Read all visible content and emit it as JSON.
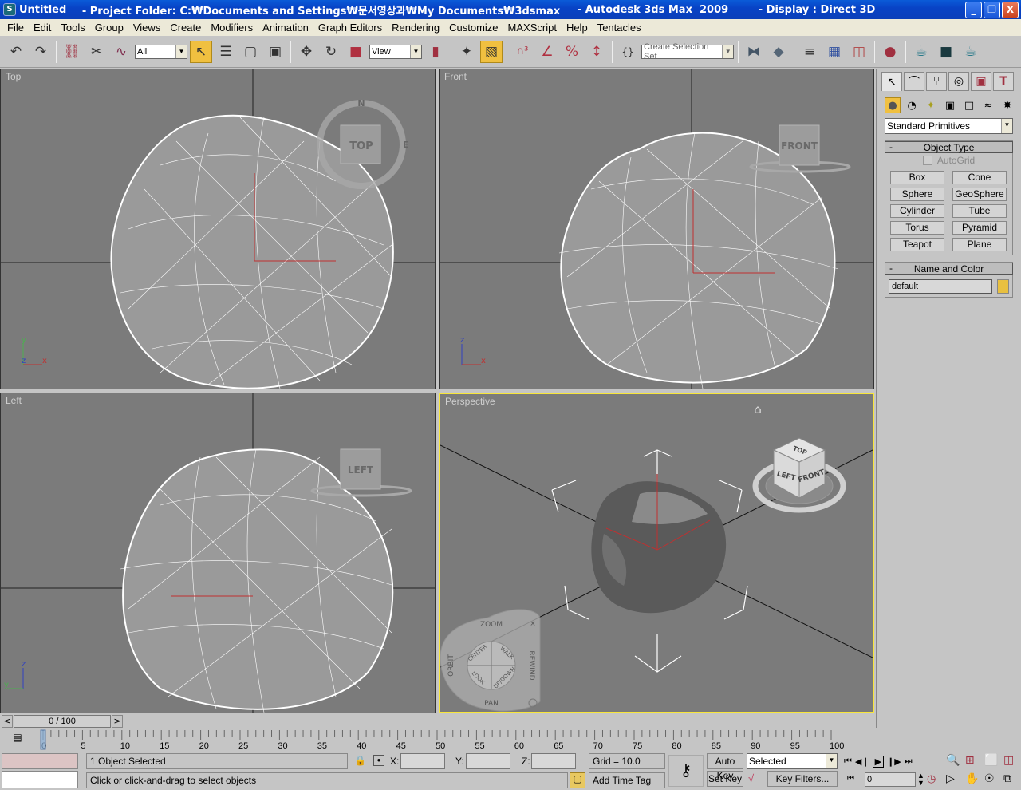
{
  "window": {
    "title": "Untitled",
    "project_folder": "   - Project Folder: C:₩Documents and Settings₩문서영상과₩My Documents₩3dsmax",
    "app": "   - Autodesk 3ds Max  2009",
    "display": "   - Display : Direct 3D",
    "controls": {
      "minimize": "_",
      "restore": "❐",
      "close": "X"
    }
  },
  "menu": [
    "File",
    "Edit",
    "Tools",
    "Group",
    "Views",
    "Create",
    "Modifiers",
    "Animation",
    "Graph Editors",
    "Rendering",
    "Customize",
    "MAXScript",
    "Help",
    "Tentacles"
  ],
  "toolbar": {
    "selection_filter": "All",
    "reference_coord": "View",
    "named_selection_placeholder": "Create Selection Set",
    "icons": {
      "undo": "↶",
      "redo": "↷",
      "link": "⛓",
      "unlink": "✂",
      "bind": "∿",
      "select": "↖",
      "select_by_name": "☰",
      "rect_region": "▢",
      "window_crossing": "▣",
      "move": "✥",
      "rotate": "↻",
      "scale": "■",
      "pivot": "▮",
      "manipulate": "✦",
      "keyboard_shortcut": "▧",
      "snap3": "∩³",
      "angle_snap": "∠",
      "percent_snap": "%",
      "spinner_snap": "↕",
      "edit_named": "{}",
      "mirror": "⧓",
      "align": "◆",
      "layers": "≡",
      "curve_editor": "▦",
      "schematic": "◫",
      "material_editor": "●",
      "render_setup": "☕",
      "render_frame": "■",
      "quick_render": "☕"
    }
  },
  "viewports": [
    {
      "name": "Top",
      "gizmo": "TOP",
      "compass": [
        "N",
        "E"
      ],
      "axes": [
        "y",
        "z",
        "x"
      ]
    },
    {
      "name": "Front",
      "gizmo": "FRONT",
      "axes": [
        "z",
        "x"
      ]
    },
    {
      "name": "Left",
      "gizmo": "LEFT",
      "axes": [
        "z",
        "y"
      ]
    },
    {
      "name": "Perspective",
      "viewcube": [
        "TOP",
        "LEFT",
        "FRONT"
      ],
      "home": "⌂",
      "wheel": [
        "ZOOM",
        "CENTER",
        "WALK",
        "ORBIT",
        "REWIND",
        "LOOK",
        "UP/DOWN",
        "PAN"
      ]
    }
  ],
  "command_panel": {
    "tabs": [
      "↖",
      "⌒",
      "⑂",
      "◎",
      "▣",
      "T"
    ],
    "categories": [
      "●",
      "◔",
      "✦",
      "▣",
      "□",
      "≈",
      "✸"
    ],
    "category_dropdown": "Standard Primitives",
    "object_type": {
      "header": "Object Type",
      "autogrid": "AutoGrid",
      "buttons": [
        "Box",
        "Cone",
        "Sphere",
        "GeoSphere",
        "Cylinder",
        "Tube",
        "Torus",
        "Pyramid",
        "Teapot",
        "Plane"
      ]
    },
    "name_color": {
      "header": "Name and Color",
      "name": "default",
      "color": "#e8c040"
    }
  },
  "timeline": {
    "slider": "0 / 100",
    "prev": "<",
    "next": ">",
    "ticks": [
      "0",
      "5",
      "10",
      "15",
      "20",
      "25",
      "30",
      "35",
      "40",
      "45",
      "50",
      "55",
      "60",
      "65",
      "70",
      "75",
      "80",
      "85",
      "90",
      "95",
      "100"
    ]
  },
  "status": {
    "selection": "1 Object Selected",
    "prompt": "Click or click-and-drag to select objects",
    "x_label": "X:",
    "y_label": "Y:",
    "z_label": "Z:",
    "x": "",
    "y": "",
    "z": "",
    "grid": "Grid = 10.0",
    "add_time_tag": "Add Time Tag",
    "auto_key": "Auto Key",
    "set_key": "Set Key",
    "key_mode": "Selected",
    "key_filters": "Key Filters...",
    "frame": "0"
  }
}
